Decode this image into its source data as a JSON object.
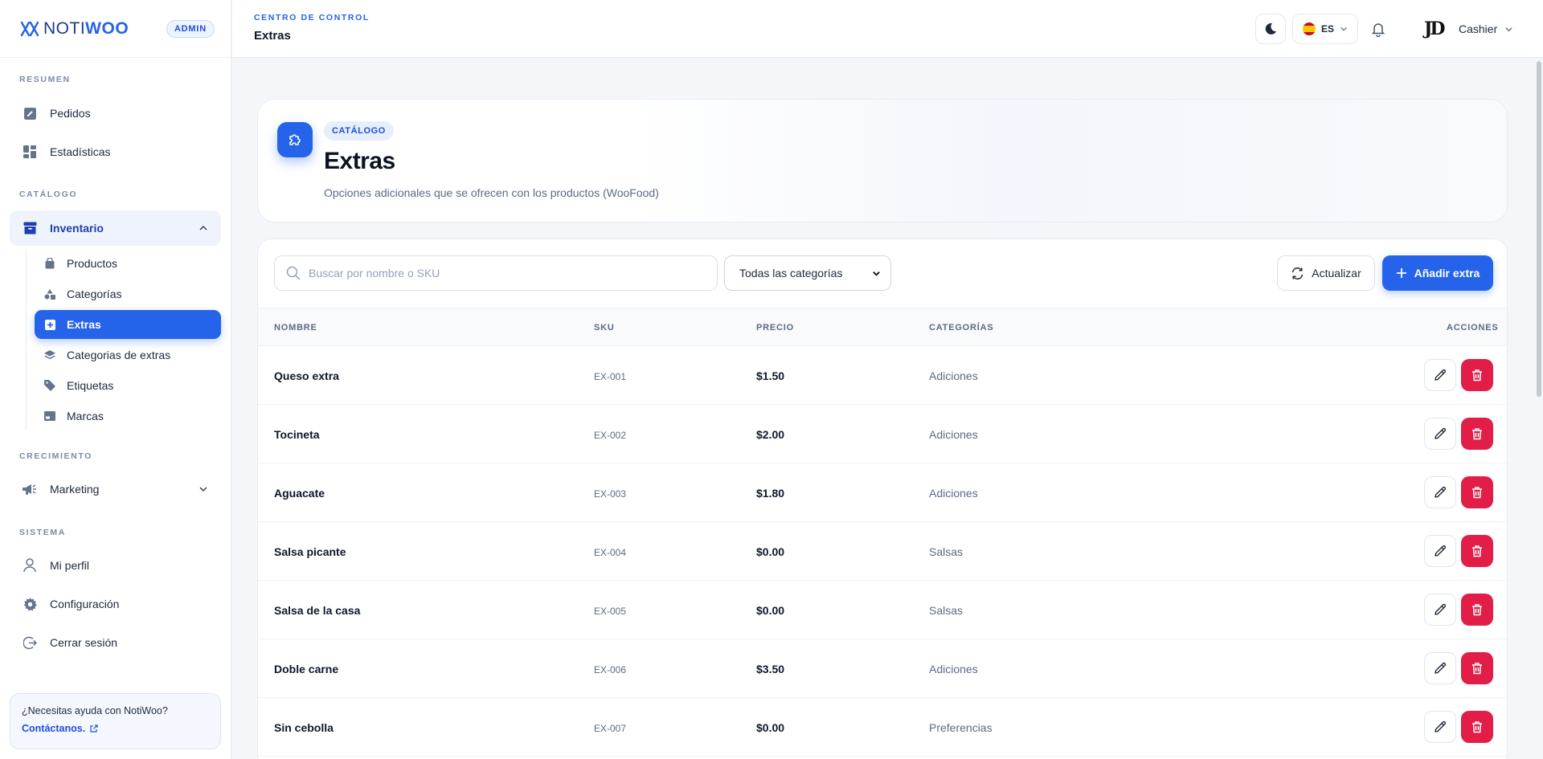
{
  "brand": {
    "name_light": "NOTI",
    "name_bold": "WOO",
    "badge": "ADMIN"
  },
  "sidebar": {
    "sections": {
      "resumen": "RESUMEN",
      "catalogo": "CATÁLOGO",
      "crecimiento": "CRECIMIENTO",
      "sistema": "SISTEMA"
    },
    "items": {
      "pedidos": "Pedidos",
      "estadisticas": "Estadísticas",
      "inventario": "Inventario",
      "marketing": "Marketing",
      "perfil": "Mi perfil",
      "configuracion": "Configuración",
      "logout": "Cerrar sesión"
    },
    "sub": [
      "Productos",
      "Categorías",
      "Extras",
      "Categorias de extras",
      "Etiquetas",
      "Marcas"
    ],
    "help": {
      "question": "¿Necesitas ayuda con NotiWoo?",
      "contact": "Contáctanos."
    }
  },
  "header": {
    "kicker": "CENTRO DE CONTROL",
    "title": "Extras",
    "language": "ES",
    "user_initials": "JD",
    "user_name": "Cashier"
  },
  "hero": {
    "badge": "CATÁLOGO",
    "title": "Extras",
    "subtitle": "Opciones adicionales que se ofrecen con los productos (WooFood)"
  },
  "toolbar": {
    "search_placeholder": "Buscar por nombre o SKU",
    "category_filter": "Todas las categorías",
    "refresh": "Actualizar",
    "add": "Añadir extra"
  },
  "table": {
    "headers": {
      "name": "NOMBRE",
      "sku": "SKU",
      "price": "PRECIO",
      "categories": "CATEGORÍAS",
      "actions": "ACCIONES"
    },
    "rows": [
      {
        "name": "Queso extra",
        "sku": "EX-001",
        "price": "$1.50",
        "category": "Adiciones"
      },
      {
        "name": "Tocineta",
        "sku": "EX-002",
        "price": "$2.00",
        "category": "Adiciones"
      },
      {
        "name": "Aguacate",
        "sku": "EX-003",
        "price": "$1.80",
        "category": "Adiciones"
      },
      {
        "name": "Salsa picante",
        "sku": "EX-004",
        "price": "$0.00",
        "category": "Salsas"
      },
      {
        "name": "Salsa de la casa",
        "sku": "EX-005",
        "price": "$0.00",
        "category": "Salsas"
      },
      {
        "name": "Doble carne",
        "sku": "EX-006",
        "price": "$3.50",
        "category": "Adiciones"
      },
      {
        "name": "Sin cebolla",
        "sku": "EX-007",
        "price": "$0.00",
        "category": "Preferencias"
      }
    ]
  },
  "colors": {
    "primary": "#2563eb",
    "danger": "#e11d48",
    "sidebar_active_bg": "#eef3fc"
  }
}
